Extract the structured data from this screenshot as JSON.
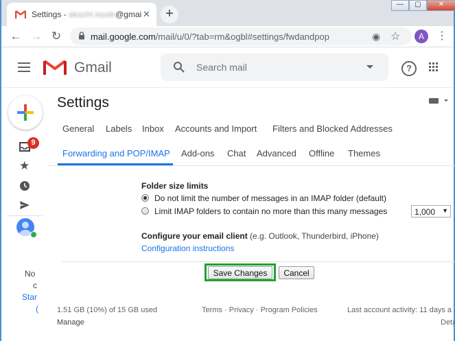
{
  "browser": {
    "tab_title_prefix": "Settings - ",
    "tab_title_redacted": "akasht.lepde",
    "tab_title_suffix": "@gmail.c",
    "tab_close": "✕",
    "new_tab": "+",
    "url_host": "mail.google.com",
    "url_path": "/mail/u/0/?tab=rm&ogbl#settings/fwdandpop",
    "profile_initial": "A"
  },
  "gmail": {
    "logo_text": "Gmail",
    "search_placeholder": "Search mail",
    "help_label": "?"
  },
  "rail": {
    "inbox_badge": "9",
    "hangouts_text_1": "No",
    "hangouts_text_2": "c",
    "hangouts_link": "Star",
    "hangouts_text_3": "("
  },
  "settings": {
    "title": "Settings",
    "tabs_row1": [
      "General",
      "Labels",
      "Inbox",
      "Accounts and Import",
      "Filters and Blocked Addresses"
    ],
    "tabs_row2": [
      "Forwarding and POP/IMAP",
      "Add-ons",
      "Chat",
      "Advanced",
      "Offline",
      "Themes"
    ],
    "folder_heading": "Folder size limits",
    "radio_no_limit": "Do not limit the number of messages in an IMAP folder (default)",
    "radio_limit": "Limit IMAP folders to contain no more than this many messages",
    "limit_value": "1,000",
    "client_heading": "Configure your email client",
    "client_examples": " (e.g. Outlook, Thunderbird, iPhone)",
    "config_link": "Configuration instructions",
    "save_button": "Save Changes",
    "cancel_button": "Cancel"
  },
  "footer": {
    "storage": "1.51 GB (10%) of 15 GB used",
    "manage": "Manage",
    "terms": "Terms",
    "privacy": "Privacy",
    "program_policies": "Program Policies",
    "separator": " · ",
    "last_activity": "Last account activity: 11 days a",
    "details": "Deta"
  },
  "colors": {
    "accent_blue": "#1a73e8",
    "badge_red": "#d93025",
    "highlight_green": "#1ea32b"
  }
}
